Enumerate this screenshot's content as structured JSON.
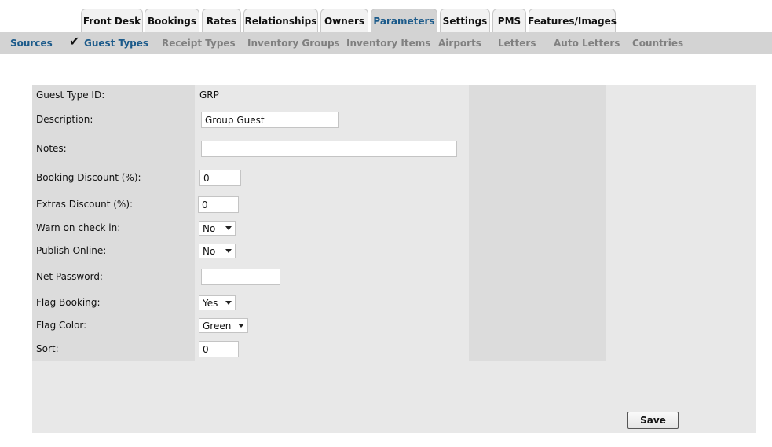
{
  "tabs": [
    {
      "label": "Front Desk",
      "active": false
    },
    {
      "label": "Bookings",
      "active": false
    },
    {
      "label": "Rates",
      "active": false
    },
    {
      "label": "Relationships",
      "active": false
    },
    {
      "label": "Owners",
      "active": false
    },
    {
      "label": "Parameters",
      "active": true
    },
    {
      "label": "Settings",
      "active": false
    },
    {
      "label": "PMS",
      "active": false
    },
    {
      "label": "Features/Images",
      "active": false
    }
  ],
  "subnav": [
    {
      "label": "Sources",
      "color": "#1b5a8a"
    },
    {
      "label": "Guest Types",
      "color": "#1b5a8a",
      "selected": true
    },
    {
      "label": "Receipt Types"
    },
    {
      "label": "Inventory Groups"
    },
    {
      "label": "Inventory Items"
    },
    {
      "label": "Airports"
    },
    {
      "label": "Letters"
    },
    {
      "label": "Auto Letters"
    },
    {
      "label": "Countries"
    }
  ],
  "form": {
    "guest_type_id_label": "Guest Type ID:",
    "guest_type_id_value": "GRP",
    "description_label": "Description:",
    "description_value": "Group Guest",
    "notes_label": "Notes:",
    "notes_value": "",
    "booking_discount_label": "Booking Discount (%):",
    "booking_discount_value": "0",
    "extras_discount_label": "Extras Discount (%):",
    "extras_discount_value": "0",
    "warn_checkin_label": "Warn on check in:",
    "warn_checkin_value": "No",
    "publish_online_label": "Publish Online:",
    "publish_online_value": "No",
    "net_password_label": "Net Password:",
    "net_password_value": "",
    "flag_booking_label": "Flag Booking:",
    "flag_booking_value": "Yes",
    "flag_color_label": "Flag Color:",
    "flag_color_value": "Green",
    "sort_label": "Sort:",
    "sort_value": "0"
  },
  "save_label": "Save"
}
